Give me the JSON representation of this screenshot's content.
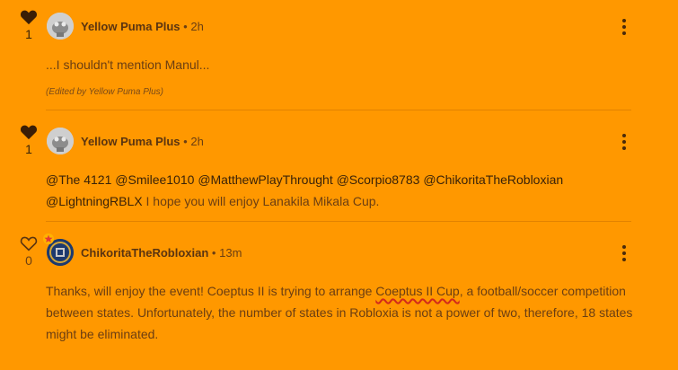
{
  "posts": [
    {
      "likes": "1",
      "liked": true,
      "author": "Yellow Puma Plus",
      "separator": "•",
      "time": "2h",
      "text": "...I shouldn't mention Manul...",
      "edited_note": "(Edited by Yellow Puma Plus)"
    },
    {
      "likes": "1",
      "liked": true,
      "author": "Yellow Puma Plus",
      "separator": "•",
      "time": "2h",
      "mentions": [
        "@The 4121",
        "@Smilee1010",
        "@MatthewPlayThrought",
        "@Scorpio8783",
        "@ChikoritaTheRobloxian",
        "@LightningRBLX"
      ],
      "text_after_mentions": "I hope you will enjoy Lanakila Mikala Cup."
    },
    {
      "likes": "0",
      "liked": false,
      "author": "ChikoritaTheRobloxian",
      "separator": "•",
      "time": "13m",
      "text_part1": "Thanks, will enjoy the event! Coeptus II is trying to arrange ",
      "misspelled": "Coeptus II Cup",
      "text_part2": ", a football/soccer competition between states. Unfortunately, the number of states in Robloxia is not a power of two, therefore, 18 states might be eliminated."
    }
  ],
  "icons": {
    "like": "heart-icon",
    "menu": "more-vertical-icon",
    "badge": "star-badge-icon"
  },
  "colors": {
    "background": "#ff9800",
    "heart_filled": "#3a1e06",
    "spellcheck": "#d22a1a"
  }
}
